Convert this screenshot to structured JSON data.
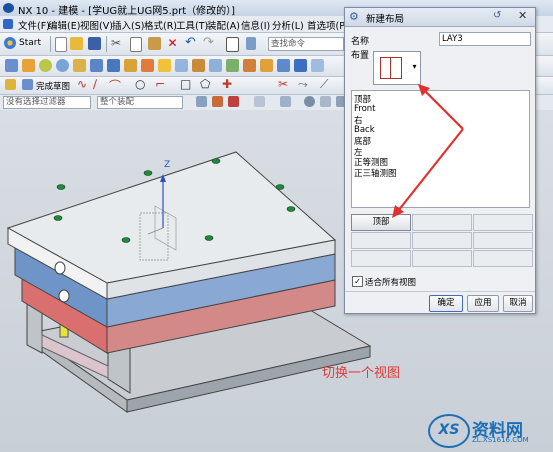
{
  "window": {
    "title": "NX 10 - 建模 - [学UG就上UG网5.prt（修改的）]"
  },
  "menus": [
    "文件(F)",
    "编辑(E)",
    "视图(V)",
    "插入(S)",
    "格式(R)",
    "工具(T)",
    "装配(A)",
    "信息(I)",
    "分析(L)",
    "首选项(P)"
  ],
  "toolbar": {
    "start_label": "Start",
    "command_search_placeholder": "查找命令",
    "sketch_label": "完成草图"
  },
  "filters": {
    "selection_filter": "没有选择过滤器",
    "assembly_scope": "整个装配"
  },
  "dialog": {
    "title": "新建布局",
    "name_label": "名称",
    "name_value": "LAY3",
    "layout_label": "布置",
    "views": [
      "顶部",
      "Front",
      "右",
      "Back",
      "底部",
      "左",
      "正等测图",
      "正三轴测图"
    ],
    "slot_button": "顶部",
    "fit_all_label": "适合所有视图",
    "fit_all_checked": true,
    "ok": "确定",
    "apply": "应用",
    "cancel": "取消"
  },
  "annotation": "切换一个视图",
  "triad": {
    "z_label": "Z"
  },
  "watermark": {
    "text": "资料网",
    "url": "ZL.XS1616.COM"
  }
}
